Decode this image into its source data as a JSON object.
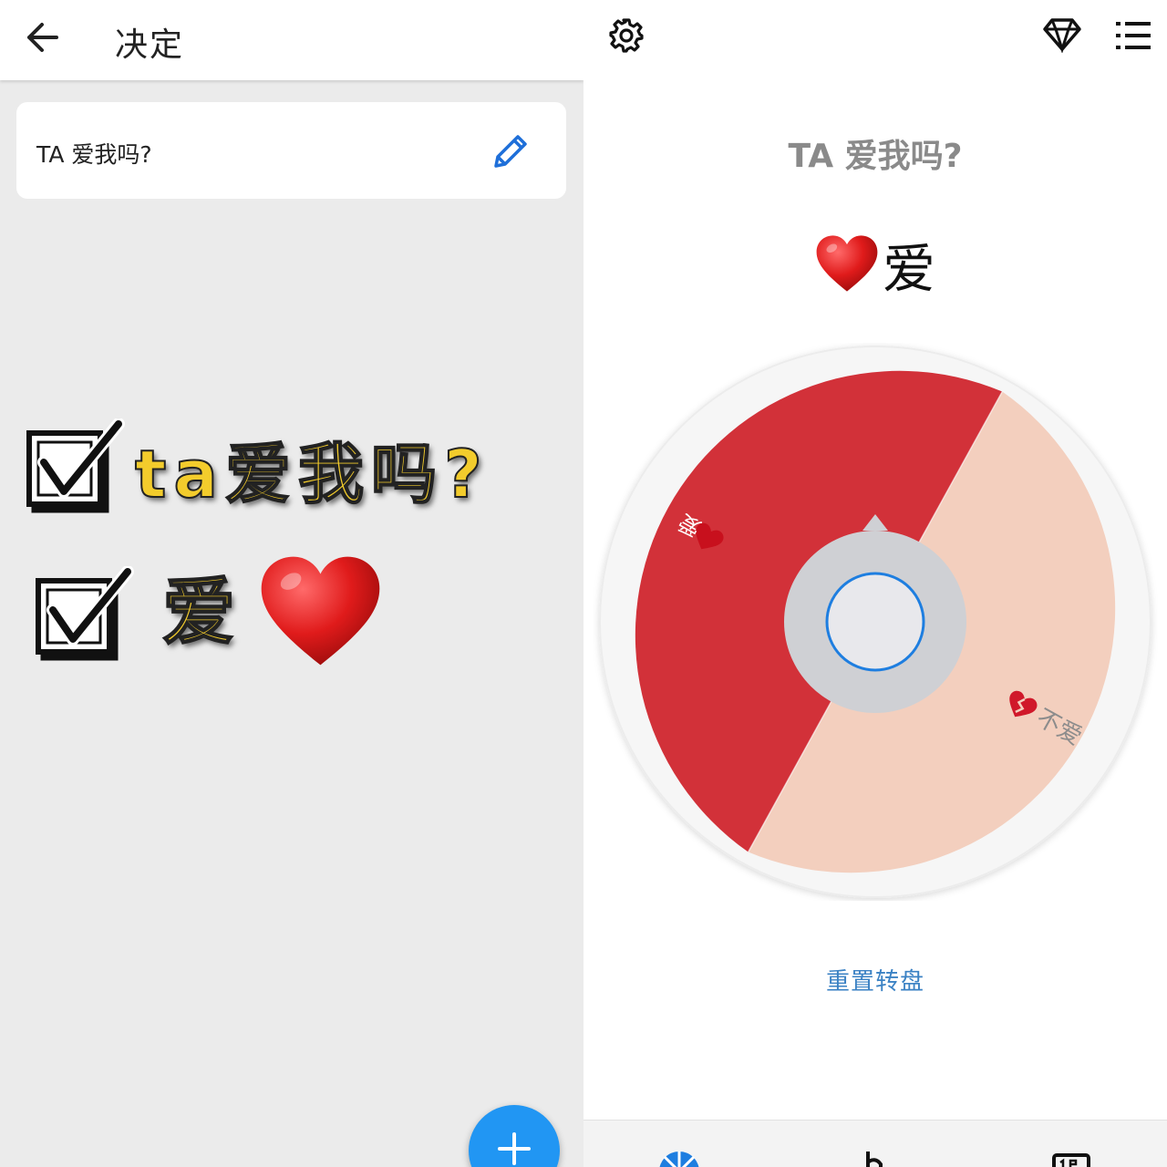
{
  "left": {
    "header": {
      "title": "决定"
    },
    "question": {
      "text": "TA 爱我吗?"
    },
    "sticker": {
      "line1": "ta爱我吗?",
      "line2": "爱"
    }
  },
  "right": {
    "question": "TA 爱我吗?",
    "result": {
      "label": "爱",
      "emoji": "heart"
    },
    "wheel": {
      "segments": [
        {
          "label": "爱",
          "emoji": "heart",
          "color": "#d23139"
        },
        {
          "label": "不爱",
          "emoji": "broken-heart",
          "color": "#f3cfbe"
        }
      ]
    },
    "reset_label": "重置转盘"
  },
  "colors": {
    "accent": "#2196f3",
    "link": "#3b82c4"
  }
}
